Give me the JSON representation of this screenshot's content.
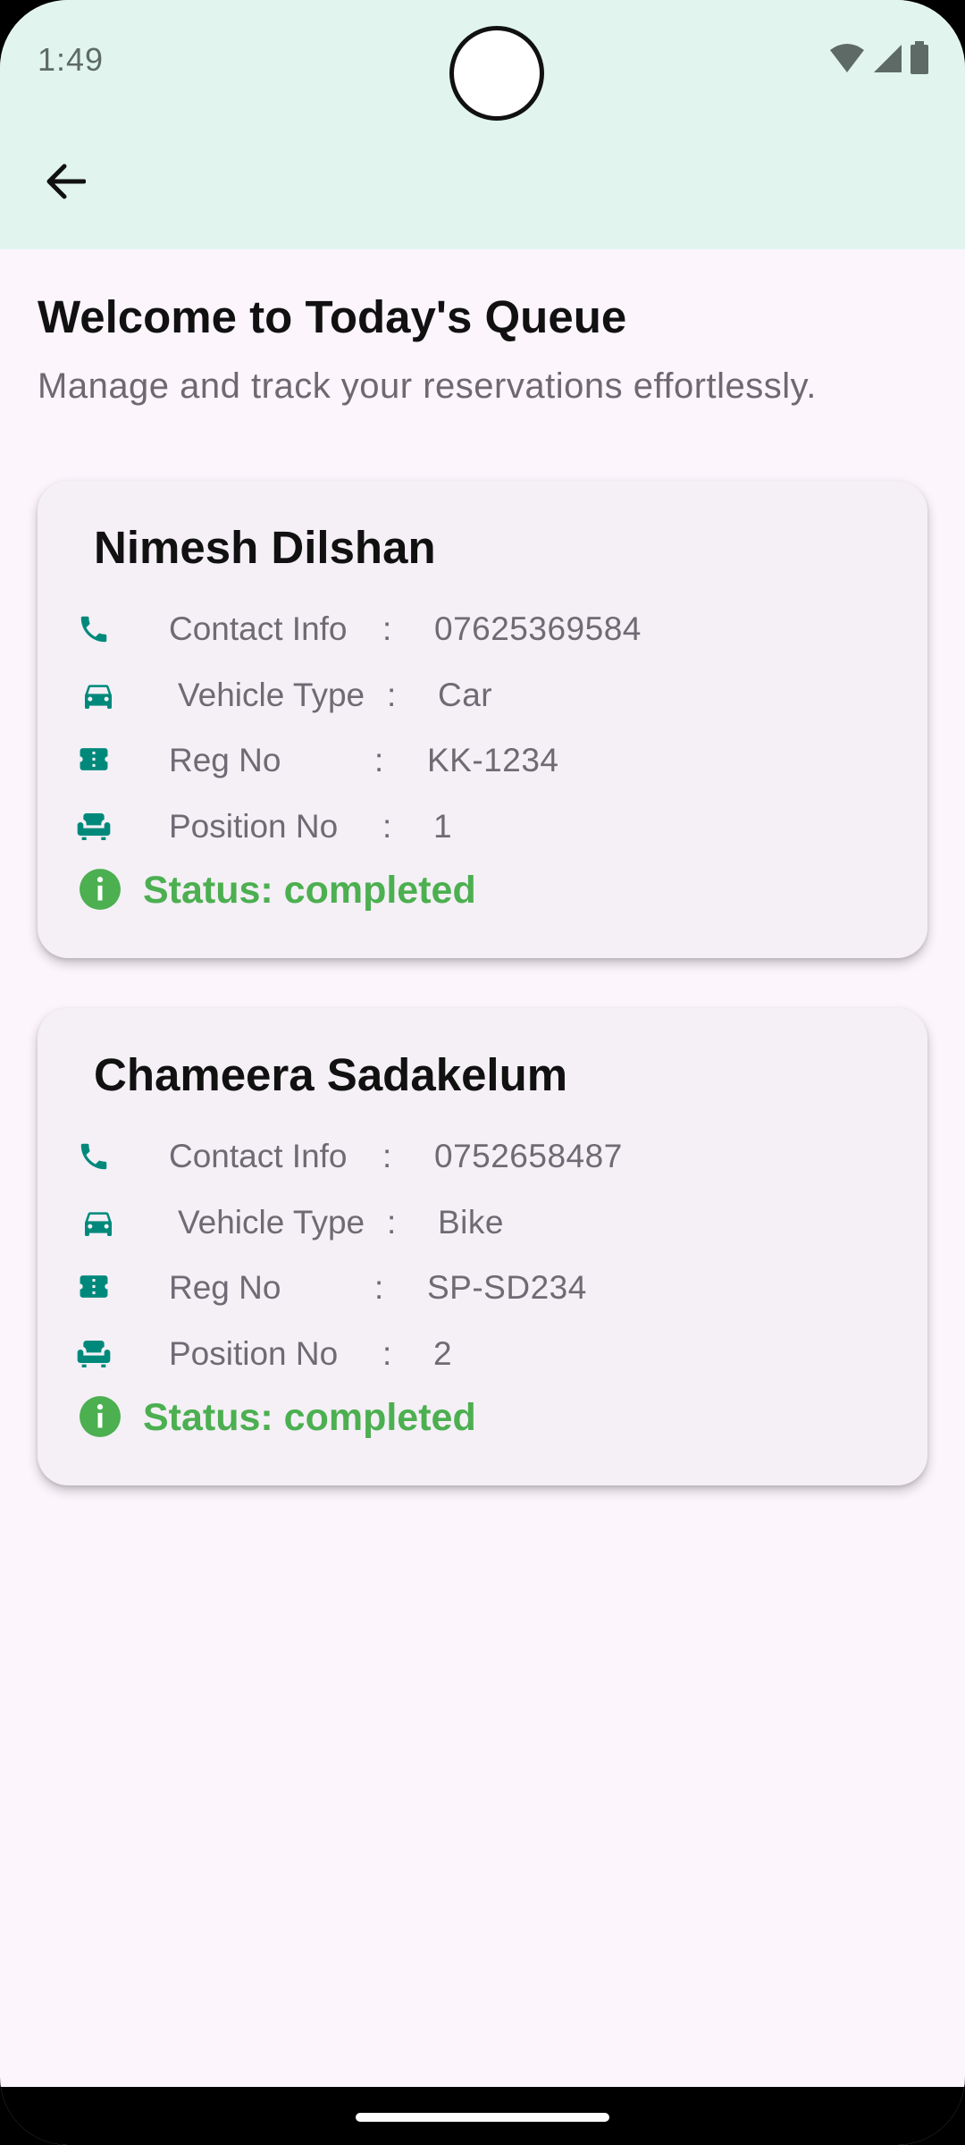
{
  "status_bar": {
    "time": "1:49"
  },
  "colors": {
    "appbar_bg": "#E1F5EE",
    "page_bg": "#FCF5FC",
    "icon_teal": "#00897B",
    "status_green": "#4CAF50"
  },
  "header": {
    "title": "Welcome to Today's Queue",
    "subtitle": "Manage and track your reservations effortlessly."
  },
  "labels": {
    "contact": "Contact Info",
    "vehicle": "Vehicle Type",
    "reg": "Reg No",
    "position": "Position No",
    "colon": ":"
  },
  "reservations": [
    {
      "name": "Nimesh Dilshan",
      "contact": "07625369584",
      "vehicle": "Car",
      "reg": "KK-1234",
      "position": "1",
      "status": "Status: completed"
    },
    {
      "name": "Chameera Sadakelum",
      "contact": "0752658487",
      "vehicle": "Bike",
      "reg": "SP-SD234",
      "position": "2",
      "status": "Status: completed"
    }
  ]
}
